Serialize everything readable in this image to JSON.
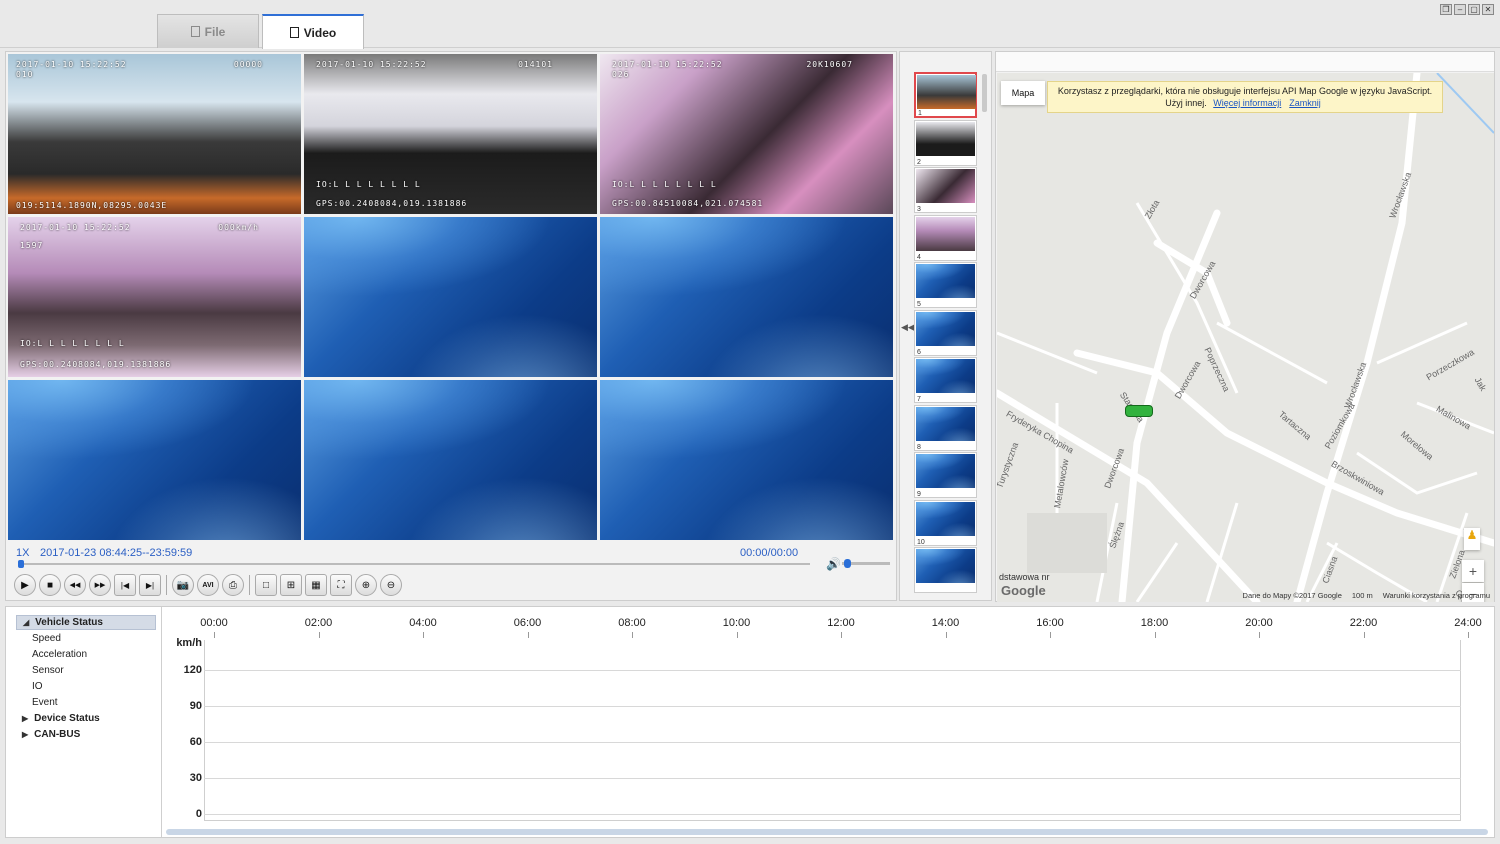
{
  "tabs": [
    {
      "label": "File",
      "active": false
    },
    {
      "label": "Video",
      "active": true
    }
  ],
  "window_controls": [
    "❐",
    "–",
    "▢",
    "✕"
  ],
  "video": {
    "cameras": [
      {
        "osd_top": "2017-01-10 15:22:52",
        "osd_top2": "010",
        "osd_right": "00000",
        "osd_mid": "",
        "osd_bottom": "019:5114.1890N,08295.0043E"
      },
      {
        "osd_top": "2017-01-10 15:22:52",
        "osd_top2": "",
        "osd_right": "014101",
        "osd_mid": "IO:L L L L L L L L",
        "osd_bottom": "GPS:00.2408084,019.1381886"
      },
      {
        "osd_top": "2017-01-10 15:22:52",
        "osd_top2": "026",
        "osd_right": "20K10607",
        "osd_mid": "IO:L L L L L L L L",
        "osd_bottom": "GPS:00.84510084,021.074581"
      },
      {
        "osd_top": "2017-01-10 15:22:52",
        "osd_top2": "1597",
        "osd_right": "000km/h",
        "osd_mid": "IO:L L L L L L L L",
        "osd_bottom": "GPS:00.2408084,019.1381886"
      }
    ],
    "empty_channels": 5,
    "speed": "1X",
    "range": "2017-01-23 08:44:25--23:59:59",
    "time": "00:00/00:00",
    "progress": 0,
    "volume": 0.05,
    "buttons": {
      "play": "▶",
      "stop": "■",
      "rewind": "◀◀",
      "forward": "▶▶",
      "prev": "|◀",
      "next": "▶|",
      "snapshot": "📷",
      "avi": "AVI",
      "print": "⎙",
      "layout1": "□",
      "layout4": "⊞",
      "layout9": "▦",
      "fullscreen": "⛶",
      "zoom_in": "⊕",
      "zoom_out": "⊖"
    }
  },
  "thumbnails": [
    "1",
    "2",
    "3",
    "4",
    "5",
    "6",
    "7",
    "8",
    "9",
    "10",
    ""
  ],
  "map": {
    "map_type": "Mapa",
    "warning": "Korzystasz z przeglądarki, która nie obsługuje interfejsu API Map Google w języku JavaScript. Użyj innej.",
    "warning_more": "Więcej informacji",
    "warning_close": "Zamknij",
    "streets": [
      "Złota",
      "Dworcowa",
      "Wrocławska",
      "Poprzeczna",
      "Stacyjna",
      "Dworcowa",
      "Fryderyka Chopina",
      "Tartaczna",
      "Wrocławska",
      "Porzeczkowa",
      "Malinowa",
      "Morelowa",
      "Poziomkowa",
      "Brzoskwiniowa",
      "Turystyczna",
      "Metalowców",
      "Dworcowa",
      "Ślężna",
      "Wrocławska",
      "Juliusza Słowackiego",
      "Ciasna",
      "Ogrodowa",
      "Wiśniowa",
      "Zielona",
      "Orze",
      "Wrocławska",
      "Jak"
    ],
    "address": "dstawowa nr",
    "logo": "Google",
    "attribution": "Dane do Mapy ©2017 Google",
    "scale": "100 m",
    "terms": "Warunki korzystania z programu"
  },
  "tree": [
    {
      "label": "Vehicle Status",
      "type": "header",
      "expanded": true
    },
    {
      "label": "Speed",
      "type": "item"
    },
    {
      "label": "Acceleration",
      "type": "item"
    },
    {
      "label": "Sensor",
      "type": "item"
    },
    {
      "label": "IO",
      "type": "item"
    },
    {
      "label": "Event",
      "type": "item"
    },
    {
      "label": "Device Status",
      "type": "header",
      "expanded": false
    },
    {
      "label": "CAN-BUS",
      "type": "header",
      "expanded": false
    }
  ],
  "chart_data": {
    "type": "line",
    "x_ticks": [
      "00:00",
      "02:00",
      "04:00",
      "06:00",
      "08:00",
      "10:00",
      "12:00",
      "14:00",
      "16:00",
      "18:00",
      "20:00",
      "22:00",
      "24:00"
    ],
    "y_unit": "km/h",
    "y_ticks": [
      "120",
      "90",
      "60",
      "30",
      "0"
    ],
    "ylim": [
      0,
      120
    ],
    "series": []
  }
}
